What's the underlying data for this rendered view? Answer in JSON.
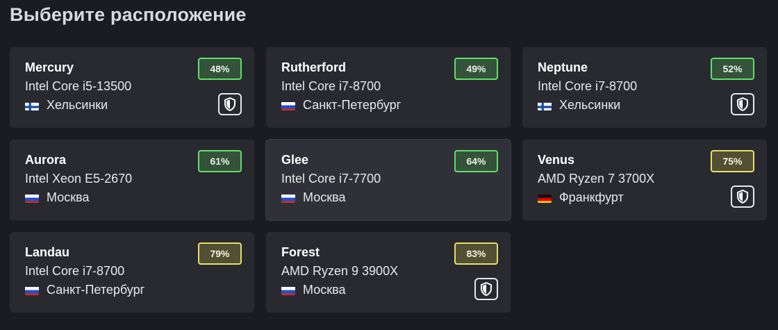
{
  "page": {
    "title": "Выберите расположение"
  },
  "servers": [
    {
      "name": "Mercury",
      "cpu": "Intel Core i5-13500",
      "location": "Хельсинки",
      "country": "finland",
      "load": "48%",
      "load_level": "low",
      "protected": true,
      "highlighted": false
    },
    {
      "name": "Rutherford",
      "cpu": "Intel Core i7-8700",
      "location": "Санкт-Петербург",
      "country": "russia",
      "load": "49%",
      "load_level": "low",
      "protected": false,
      "highlighted": false
    },
    {
      "name": "Neptune",
      "cpu": "Intel Core i7-8700",
      "location": "Хельсинки",
      "country": "finland",
      "load": "52%",
      "load_level": "low",
      "protected": true,
      "highlighted": false
    },
    {
      "name": "Aurora",
      "cpu": "Intel Xeon E5-2670",
      "location": "Москва",
      "country": "russia",
      "load": "61%",
      "load_level": "low",
      "protected": false,
      "highlighted": false
    },
    {
      "name": "Glee",
      "cpu": "Intel Core i7-7700",
      "location": "Москва",
      "country": "russia",
      "load": "64%",
      "load_level": "low",
      "protected": false,
      "highlighted": true
    },
    {
      "name": "Venus",
      "cpu": "AMD Ryzen 7 3700X",
      "location": "Франкфурт",
      "country": "germany",
      "load": "75%",
      "load_level": "mid",
      "protected": true,
      "highlighted": false
    },
    {
      "name": "Landau",
      "cpu": "Intel Core i7-8700",
      "location": "Санкт-Петербург",
      "country": "russia",
      "load": "79%",
      "load_level": "mid",
      "protected": false,
      "highlighted": false
    },
    {
      "name": "Forest",
      "cpu": "AMD Ryzen 9 3900X",
      "location": "Москва",
      "country": "russia",
      "load": "83%",
      "load_level": "mid",
      "protected": true,
      "highlighted": false
    }
  ],
  "colors": {
    "background": "#1b1c21",
    "card": "#292a30",
    "load_low_border": "#5fe06a",
    "load_mid_border": "#e3e06b"
  },
  "icons": {
    "protected": "shield-icon"
  }
}
